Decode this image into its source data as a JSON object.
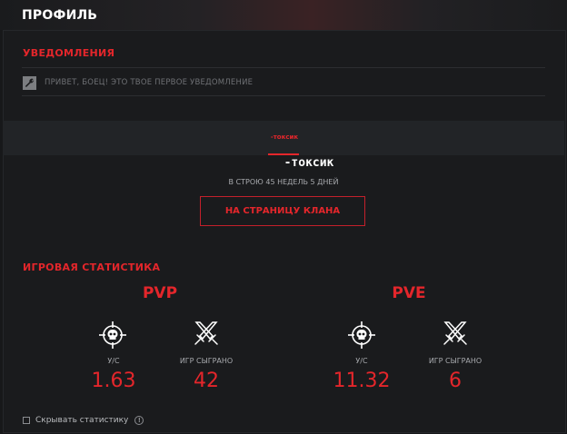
{
  "header": {
    "title": "ПРОФИЛЬ"
  },
  "notifications": {
    "title": "УВЕДОМЛЕНИЯ",
    "items": [
      {
        "icon": "wrench-icon",
        "text": "ПРИВЕТ, БОЕЦ! ЭТО ТВОЕ ПЕРВОЕ УВЕДОМЛЕНИЕ"
      }
    ]
  },
  "profile": {
    "tab_label": "-токсик",
    "nickname": "-токсик",
    "service_time": "В СТРОЮ 45 НЕДЕЛЬ 5 ДНЕЙ",
    "clan_button": "НА СТРАНИЦУ КЛАНА"
  },
  "stats": {
    "title": "ИГРОВАЯ СТАТИСТИКА",
    "pvp": {
      "title": "PVP",
      "kd_label": "У/С",
      "kd_value": "1.63",
      "games_label": "ИГР СЫГРАНО",
      "games_value": "42"
    },
    "pve": {
      "title": "PVE",
      "kd_label": "У/С",
      "kd_value": "11.32",
      "games_label": "ИГР СЫГРАНО",
      "games_value": "6"
    },
    "hide_label": "Скрывать статистику",
    "hide_checked": false
  },
  "colors": {
    "accent": "#e4262b",
    "background": "#1a1b1d",
    "band": "#222427"
  }
}
